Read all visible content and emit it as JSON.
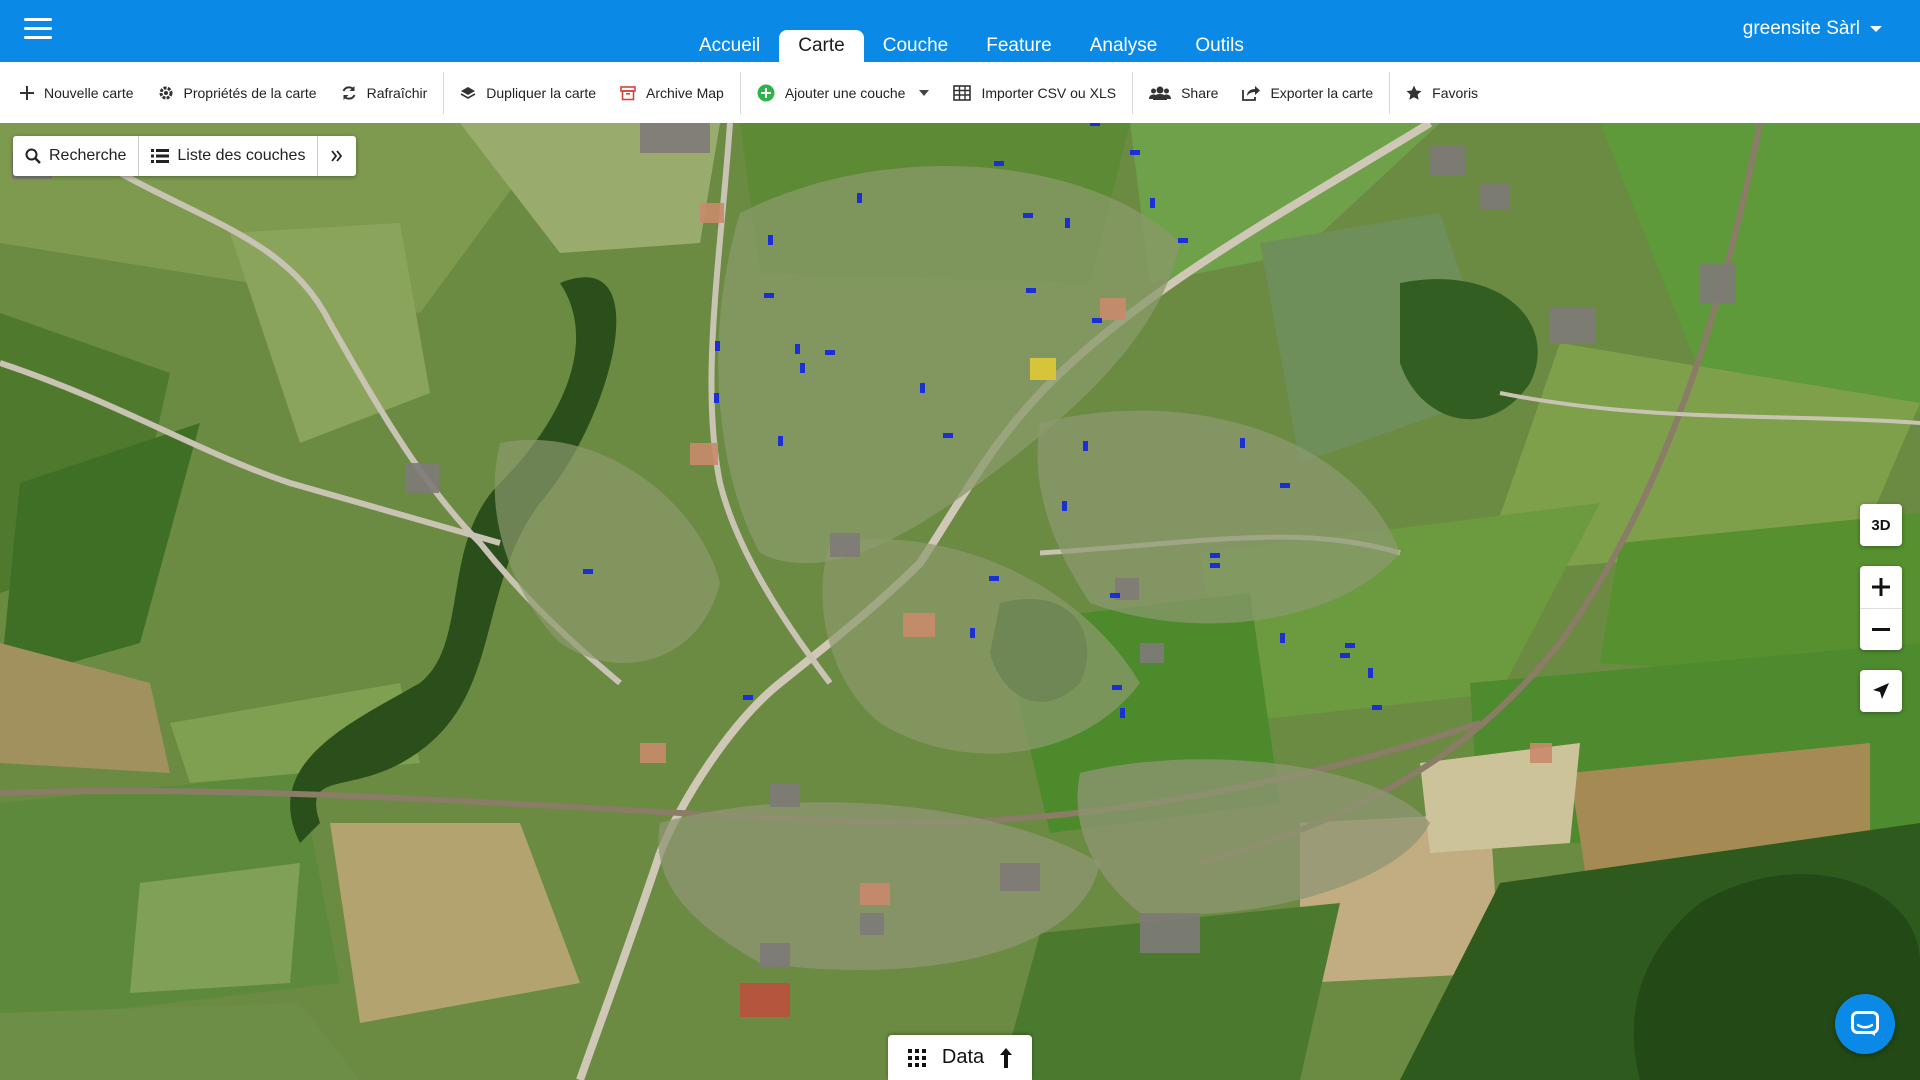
{
  "header": {
    "tabs": [
      {
        "label": "Accueil",
        "active": false
      },
      {
        "label": "Carte",
        "active": true
      },
      {
        "label": "Couche",
        "active": false
      },
      {
        "label": "Feature",
        "active": false
      },
      {
        "label": "Analyse",
        "active": false
      },
      {
        "label": "Outils",
        "active": false
      }
    ],
    "user": "greensite Sàrl",
    "accent_color": "#0a8ae6"
  },
  "toolbar": {
    "items": [
      {
        "label": "Nouvelle carte",
        "icon": "plus-icon"
      },
      {
        "label": "Propriétés de la carte",
        "icon": "gear-icon"
      },
      {
        "label": "Rafraîchir",
        "icon": "refresh-icon"
      },
      {
        "label": "Dupliquer la carte",
        "icon": "layers-icon"
      },
      {
        "label": "Archive Map",
        "icon": "archive-icon"
      },
      {
        "label": "Ajouter une couche",
        "icon": "add-circle-icon"
      },
      {
        "label": "Importer CSV ou XLS",
        "icon": "table-icon"
      },
      {
        "label": "Share",
        "icon": "users-icon"
      },
      {
        "label": "Exporter la carte",
        "icon": "export-icon"
      },
      {
        "label": "Favoris",
        "icon": "star-icon"
      }
    ]
  },
  "search_panel": {
    "search_label": "Recherche",
    "layers_label": "Liste des couches",
    "expand_icon": "double-chevron-right-icon"
  },
  "map_controls": {
    "three_d_label": "3D",
    "zoom_in_icon": "plus-icon",
    "zoom_out_icon": "minus-icon",
    "locate_icon": "navigation-arrow-icon"
  },
  "data_bar": {
    "label": "Data",
    "grid_icon": "grid-icon",
    "arrow_icon": "arrow-up-icon"
  },
  "chat": {
    "icon": "chat-icon"
  }
}
